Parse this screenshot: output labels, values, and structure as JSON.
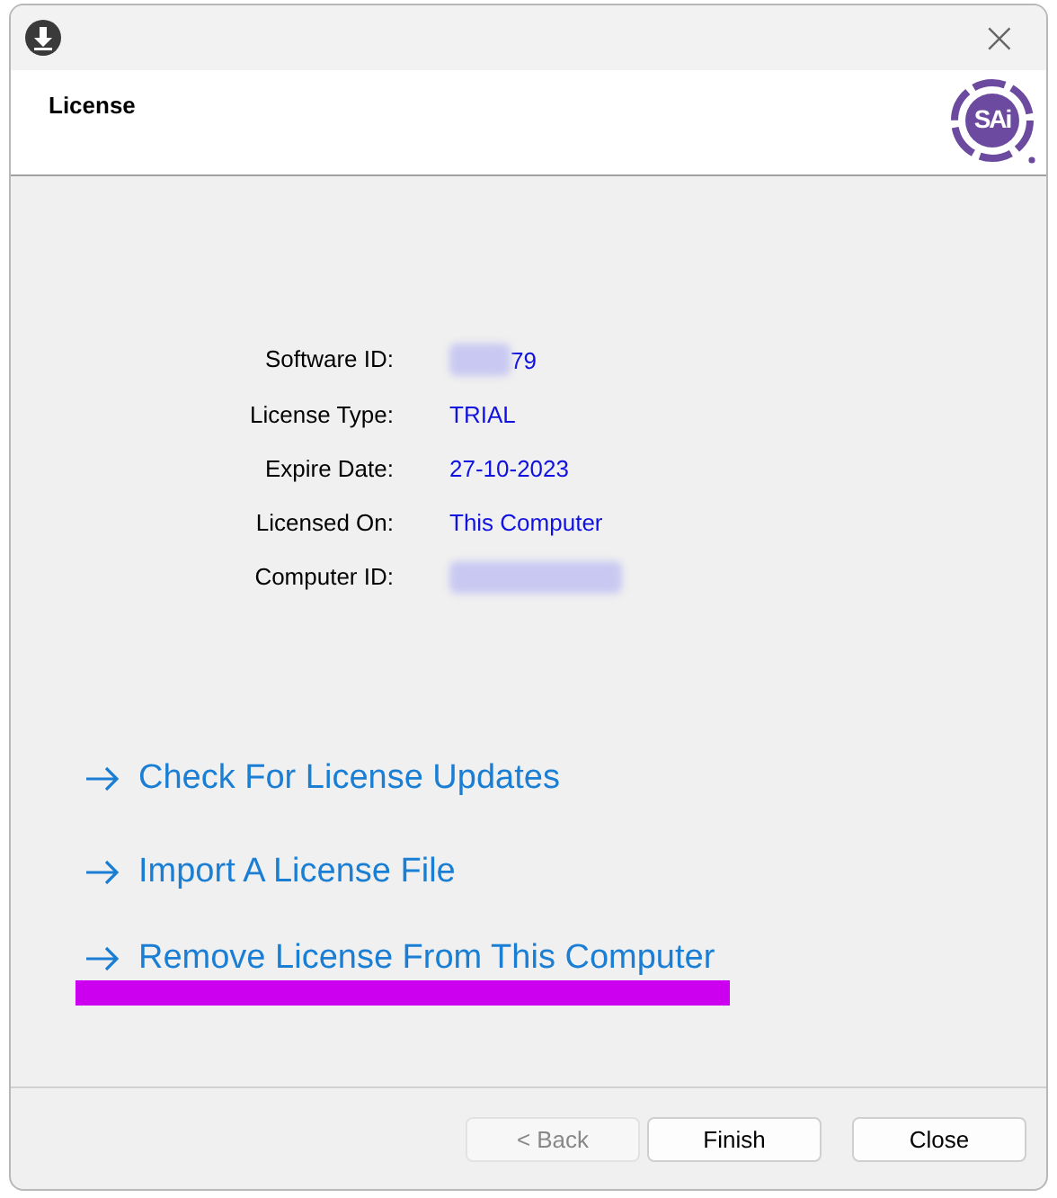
{
  "window": {
    "close": "×"
  },
  "header": {
    "title": "License",
    "logo_text": "SAi"
  },
  "details": [
    {
      "label": "Software ID:",
      "value": "79",
      "redacted": true
    },
    {
      "label": "License Type:",
      "value": "TRIAL",
      "redacted": false
    },
    {
      "label": "Expire Date:",
      "value": "27-10-2023",
      "redacted": false
    },
    {
      "label": "Licensed On:",
      "value": "This Computer",
      "redacted": false
    },
    {
      "label": "Computer ID:",
      "redacted": true
    }
  ],
  "links": [
    {
      "label": "Check For License Updates",
      "highlighted": false
    },
    {
      "label": "Import A License File",
      "highlighted": false
    },
    {
      "label": "Remove License From This Computer",
      "highlighted": true
    }
  ],
  "buttons": [
    {
      "label": "< Back",
      "disabled": true
    },
    {
      "label": "Finish",
      "disabled": false
    },
    {
      "label": "Close",
      "disabled": false
    }
  ]
}
